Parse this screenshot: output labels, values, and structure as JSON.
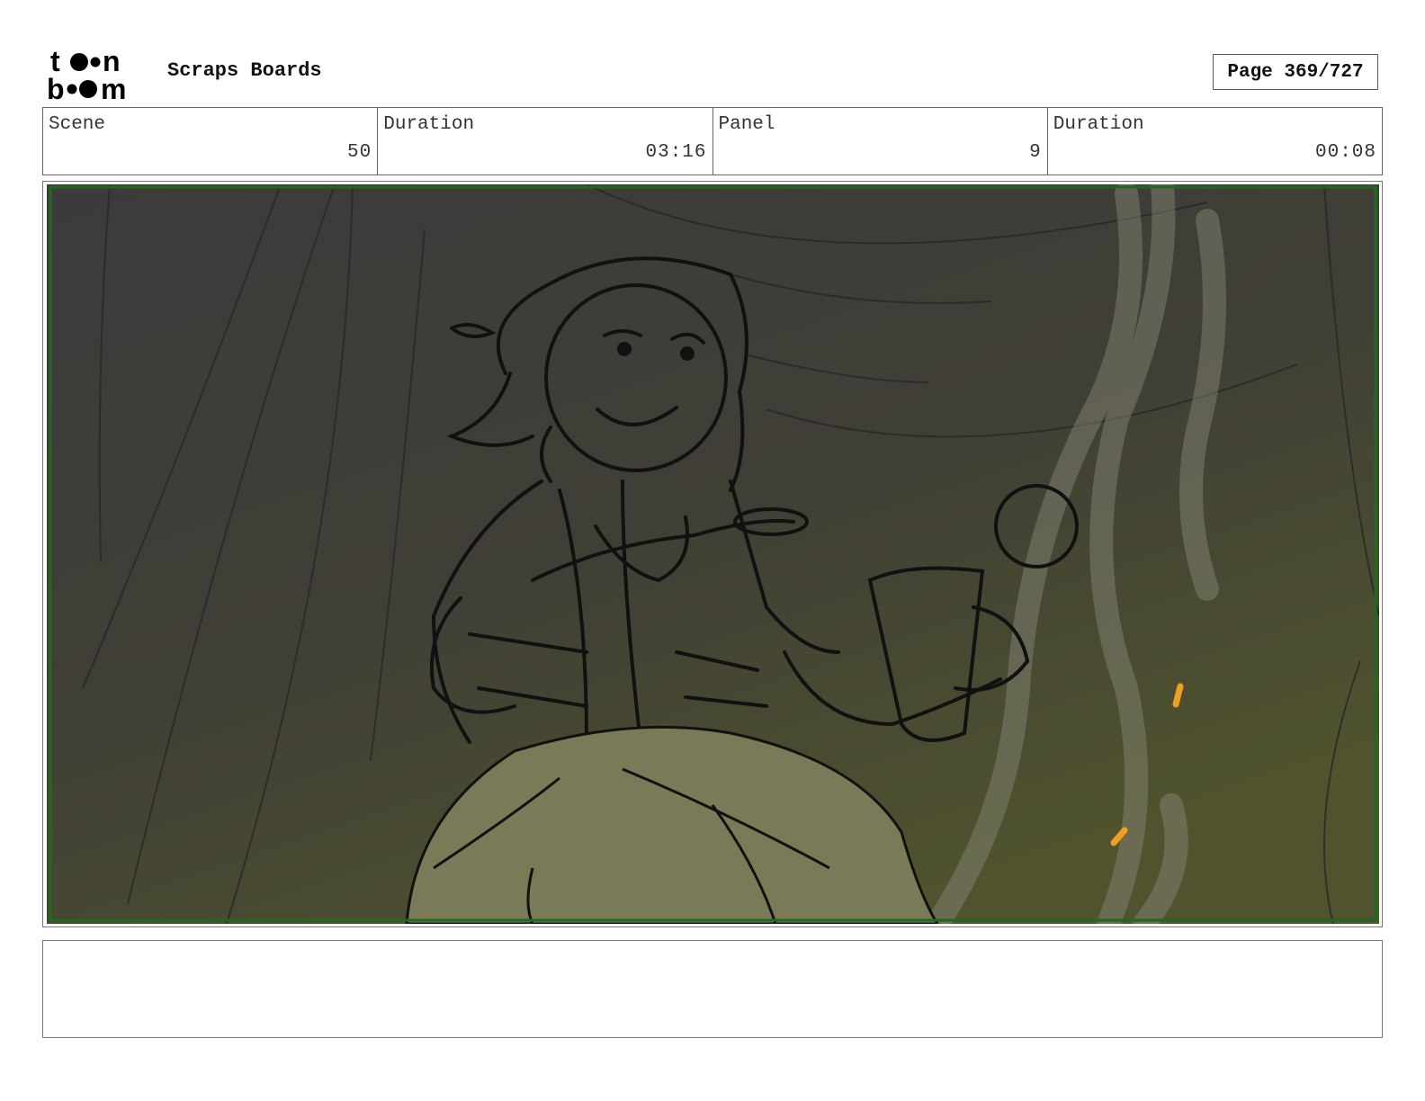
{
  "header": {
    "logo_text": "toon boom",
    "title": "Scraps Boards",
    "page_label": "Page 369/727"
  },
  "info": {
    "scene_label": "Scene",
    "scene_value": "50",
    "scene_duration_label": "Duration",
    "scene_duration_value": "03:16",
    "panel_label": "Panel",
    "panel_value": "9",
    "panel_duration_label": "Duration",
    "panel_duration_value": "00:08"
  },
  "panel": {
    "description": "",
    "colors": {
      "background_dark": "#3a3a3a",
      "background_warm": "#4e5230",
      "safe_frame": "#1e6b1e",
      "foreground_blob": "#7a7a58",
      "sparks": "#f0a020"
    }
  },
  "notes": {
    "text": ""
  }
}
